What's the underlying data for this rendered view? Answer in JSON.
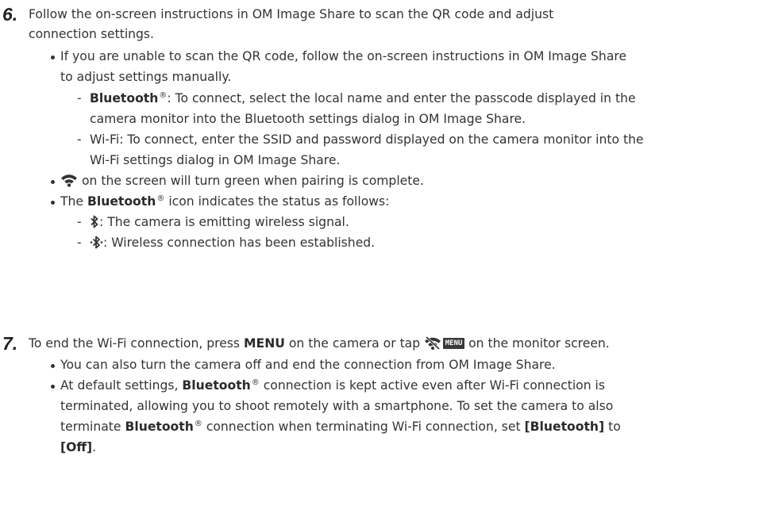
{
  "step6": {
    "number": "6.",
    "text_line1": "Follow the on-screen instructions in OM Image Share to scan the QR code and adjust",
    "text_line2": "connection settings.",
    "bullet1": {
      "line1": "If you are unable to scan the QR code, follow the on-screen instructions in OM Image Share",
      "line2": "to adjust settings manually.",
      "sub1": {
        "dash": "-",
        "term": "Bluetooth",
        "reg": "®",
        "line1_rest": ": To connect, select the local name and enter the passcode displayed in the",
        "line2": "camera monitor into the Bluetooth settings dialog in OM Image Share."
      },
      "sub2": {
        "dash": "-",
        "line1": "Wi-Fi: To connect, enter the SSID and password displayed on the camera monitor into the",
        "line2": "Wi-Fi settings dialog in OM Image Share."
      }
    },
    "bullet2": {
      "icon": "wifi-icon",
      "text": "on the screen will turn green when pairing is complete."
    },
    "bullet3": {
      "prefix": "The",
      "term": "Bluetooth",
      "reg": "®",
      "rest": "icon indicates the status as follows:",
      "sub1": {
        "dash": "-",
        "icon": "bluetooth-icon",
        "text": ": The camera is emitting wireless signal."
      },
      "sub2": {
        "dash": "-",
        "icon": "bluetooth-connected-icon",
        "text": ": Wireless connection has been established."
      }
    }
  },
  "step7": {
    "number": "7.",
    "text_pre": "To end the Wi-Fi connection, press",
    "menu_word": "MENU",
    "text_mid": "on the camera or tap",
    "icon": "wifi-off-icon",
    "menu_badge": "MENU",
    "text_post": "on the monitor screen.",
    "bullet1": "You can also turn the camera off and end the connection from OM Image Share.",
    "bullet2": {
      "l1_pre": "At default settings,",
      "l1_term": "Bluetooth",
      "reg": "®",
      "l1_post": "connection is kept active even after Wi-Fi connection is",
      "line2": "terminated, allowing you to shoot remotely with a smartphone. To set the camera to also",
      "l3_pre": "terminate",
      "l3_term": "Bluetooth",
      "l3_post": "connection when terminating Wi-Fi connection, set",
      "setting": "[Bluetooth]",
      "to": "to",
      "value": "[Off]",
      "period": "."
    }
  },
  "colors": {
    "text": "#333333",
    "heading": "#222222",
    "badge": "#3a3a3a"
  }
}
